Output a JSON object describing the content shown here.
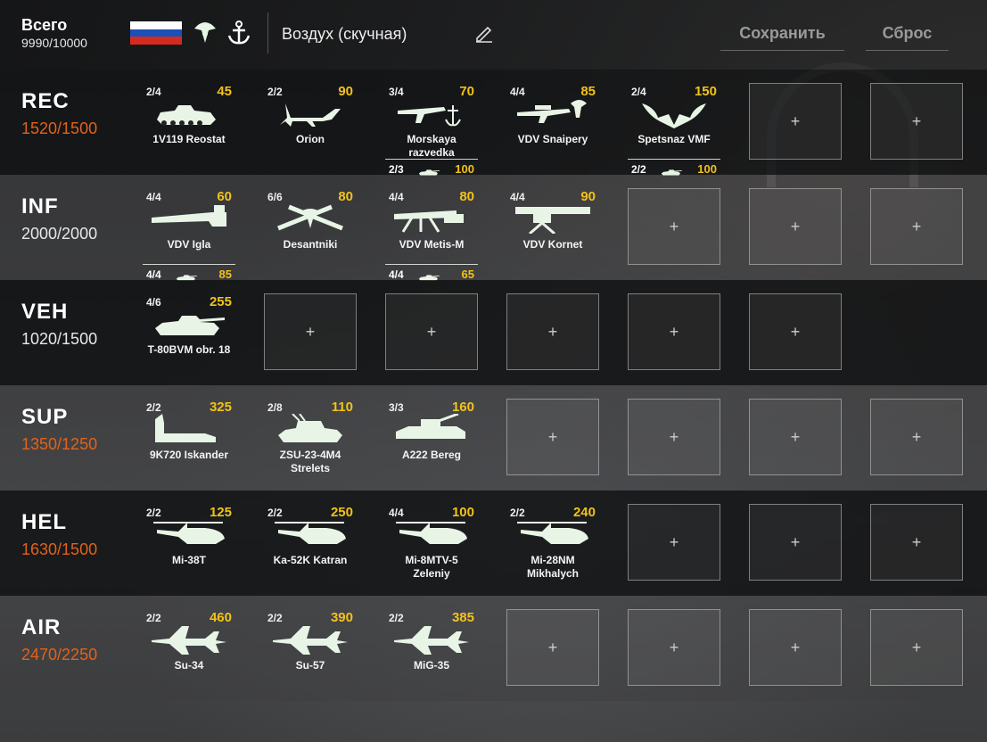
{
  "header": {
    "total_label": "Всего",
    "total_value": "9990/10000",
    "deck_name": "Воздух (скучная)",
    "save_label": "Сохранить",
    "reset_label": "Сброс",
    "flag_colors": [
      "#ffffff",
      "#1c4fb8",
      "#d52b1e"
    ],
    "icons": [
      "paratrooper-icon",
      "naval-anchor-icon",
      "pencil-icon"
    ]
  },
  "categories": [
    {
      "code": "REC",
      "points": "1520/1500",
      "over": true,
      "cards": [
        {
          "count": "2/4",
          "cost": "45",
          "name": "1V119 Reostat",
          "icon": "apc"
        },
        {
          "count": "2/2",
          "cost": "90",
          "name": "Orion",
          "icon": "drone"
        },
        {
          "count": "3/4",
          "cost": "70",
          "name": "Morskaya razvedka",
          "icon": "rifle-anchor",
          "sub": {
            "count": "2/3",
            "cost": "100",
            "icon": "tank"
          }
        },
        {
          "count": "4/4",
          "cost": "85",
          "name": "VDV Snaipery",
          "icon": "sniper"
        },
        {
          "count": "2/4",
          "cost": "150",
          "name": "Spetsnaz VMF",
          "icon": "bat",
          "sub": {
            "count": "2/2",
            "cost": "100",
            "icon": "tank"
          }
        }
      ],
      "empty": 2
    },
    {
      "code": "INF",
      "points": "2000/2000",
      "over": false,
      "cards": [
        {
          "count": "4/4",
          "cost": "60",
          "name": "VDV Igla",
          "icon": "manpad",
          "sub": {
            "count": "4/4",
            "cost": "85",
            "icon": "tank"
          }
        },
        {
          "count": "6/6",
          "cost": "80",
          "name": "Desantniki",
          "icon": "crossed-rifles"
        },
        {
          "count": "4/4",
          "cost": "80",
          "name": "VDV Metis-M",
          "icon": "atgm",
          "sub": {
            "count": "4/4",
            "cost": "65",
            "icon": "tank"
          }
        },
        {
          "count": "4/4",
          "cost": "90",
          "name": "VDV Kornet",
          "icon": "kornet"
        }
      ],
      "empty": 3
    },
    {
      "code": "VEH",
      "points": "1020/1500",
      "over": false,
      "cards": [
        {
          "count": "4/6",
          "cost": "255",
          "name": "T-80BVM obr. 18",
          "icon": "tank"
        }
      ],
      "empty": 5
    },
    {
      "code": "SUP",
      "points": "1350/1250",
      "over": true,
      "cards": [
        {
          "count": "2/2",
          "cost": "325",
          "name": "9K720 Iskander",
          "icon": "missile"
        },
        {
          "count": "2/8",
          "cost": "110",
          "name": "ZSU-23-4M4 Strelets",
          "icon": "aa-tank"
        },
        {
          "count": "3/3",
          "cost": "160",
          "name": "A222 Bereg",
          "icon": "truck-gun"
        }
      ],
      "empty": 4
    },
    {
      "code": "HEL",
      "points": "1630/1500",
      "over": true,
      "cards": [
        {
          "count": "2/2",
          "cost": "125",
          "name": "Mi-38T",
          "icon": "heli"
        },
        {
          "count": "2/2",
          "cost": "250",
          "name": "Ka-52K Katran",
          "icon": "heli"
        },
        {
          "count": "4/4",
          "cost": "100",
          "name": "Mi-8MTV-5 Zeleniy",
          "icon": "heli"
        },
        {
          "count": "2/2",
          "cost": "240",
          "name": "Mi-28NM Mikhalych",
          "icon": "heli"
        }
      ],
      "empty": 3
    },
    {
      "code": "AIR",
      "points": "2470/2250",
      "over": true,
      "cards": [
        {
          "count": "2/2",
          "cost": "460",
          "name": "Su-34",
          "icon": "jet"
        },
        {
          "count": "2/2",
          "cost": "390",
          "name": "Su-57",
          "icon": "jet"
        },
        {
          "count": "2/2",
          "cost": "385",
          "name": "MiG-35",
          "icon": "jet"
        }
      ],
      "empty": 4
    }
  ]
}
